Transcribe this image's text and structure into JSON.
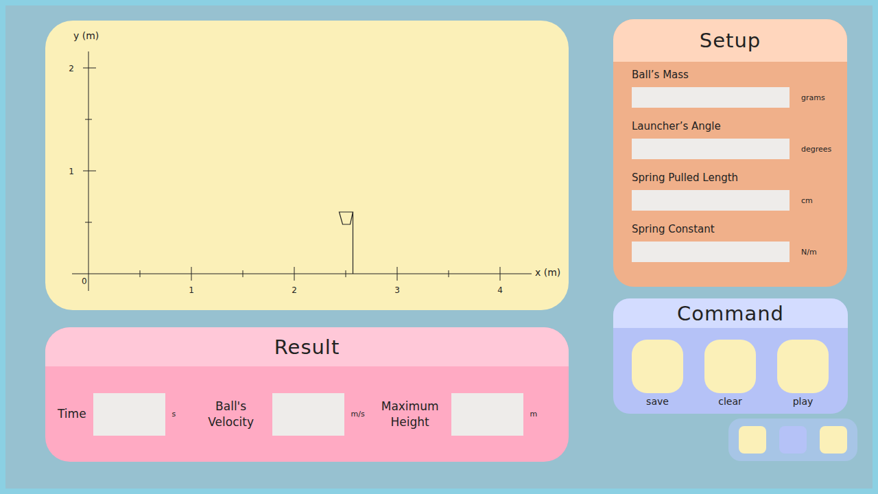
{
  "chart": {
    "x_axis": {
      "label": "x (m)",
      "ticks": [
        "1",
        "2",
        "3",
        "4"
      ]
    },
    "y_axis": {
      "label": "y (m)",
      "ticks": [
        "1",
        "2"
      ]
    },
    "origin": "0",
    "target": {
      "x": 2.57,
      "y": 0.6
    }
  },
  "result": {
    "title": "Result",
    "fields": [
      {
        "label": "Time",
        "value": "",
        "unit": "s"
      },
      {
        "label": "Ball's Velocity",
        "value": "",
        "unit": "m/s"
      },
      {
        "label": "Maximum Height",
        "value": "",
        "unit": "m"
      }
    ]
  },
  "setup": {
    "title": "Setup",
    "fields": [
      {
        "label": "Ball’s Mass",
        "value": "",
        "unit": "grams"
      },
      {
        "label": "Launcher’s Angle",
        "value": "",
        "unit": "degrees"
      },
      {
        "label": "Spring Pulled Length",
        "value": "",
        "unit": "cm"
      },
      {
        "label": "Spring Constant",
        "value": "",
        "unit": "N/m"
      }
    ]
  },
  "command": {
    "title": "Command",
    "buttons": [
      {
        "label": "save"
      },
      {
        "label": "clear"
      },
      {
        "label": "play"
      }
    ]
  },
  "mini_buttons": [
    {
      "color": "#fbf0b8"
    },
    {
      "color": "#b5c2f7"
    },
    {
      "color": "#fbf0b8"
    }
  ]
}
